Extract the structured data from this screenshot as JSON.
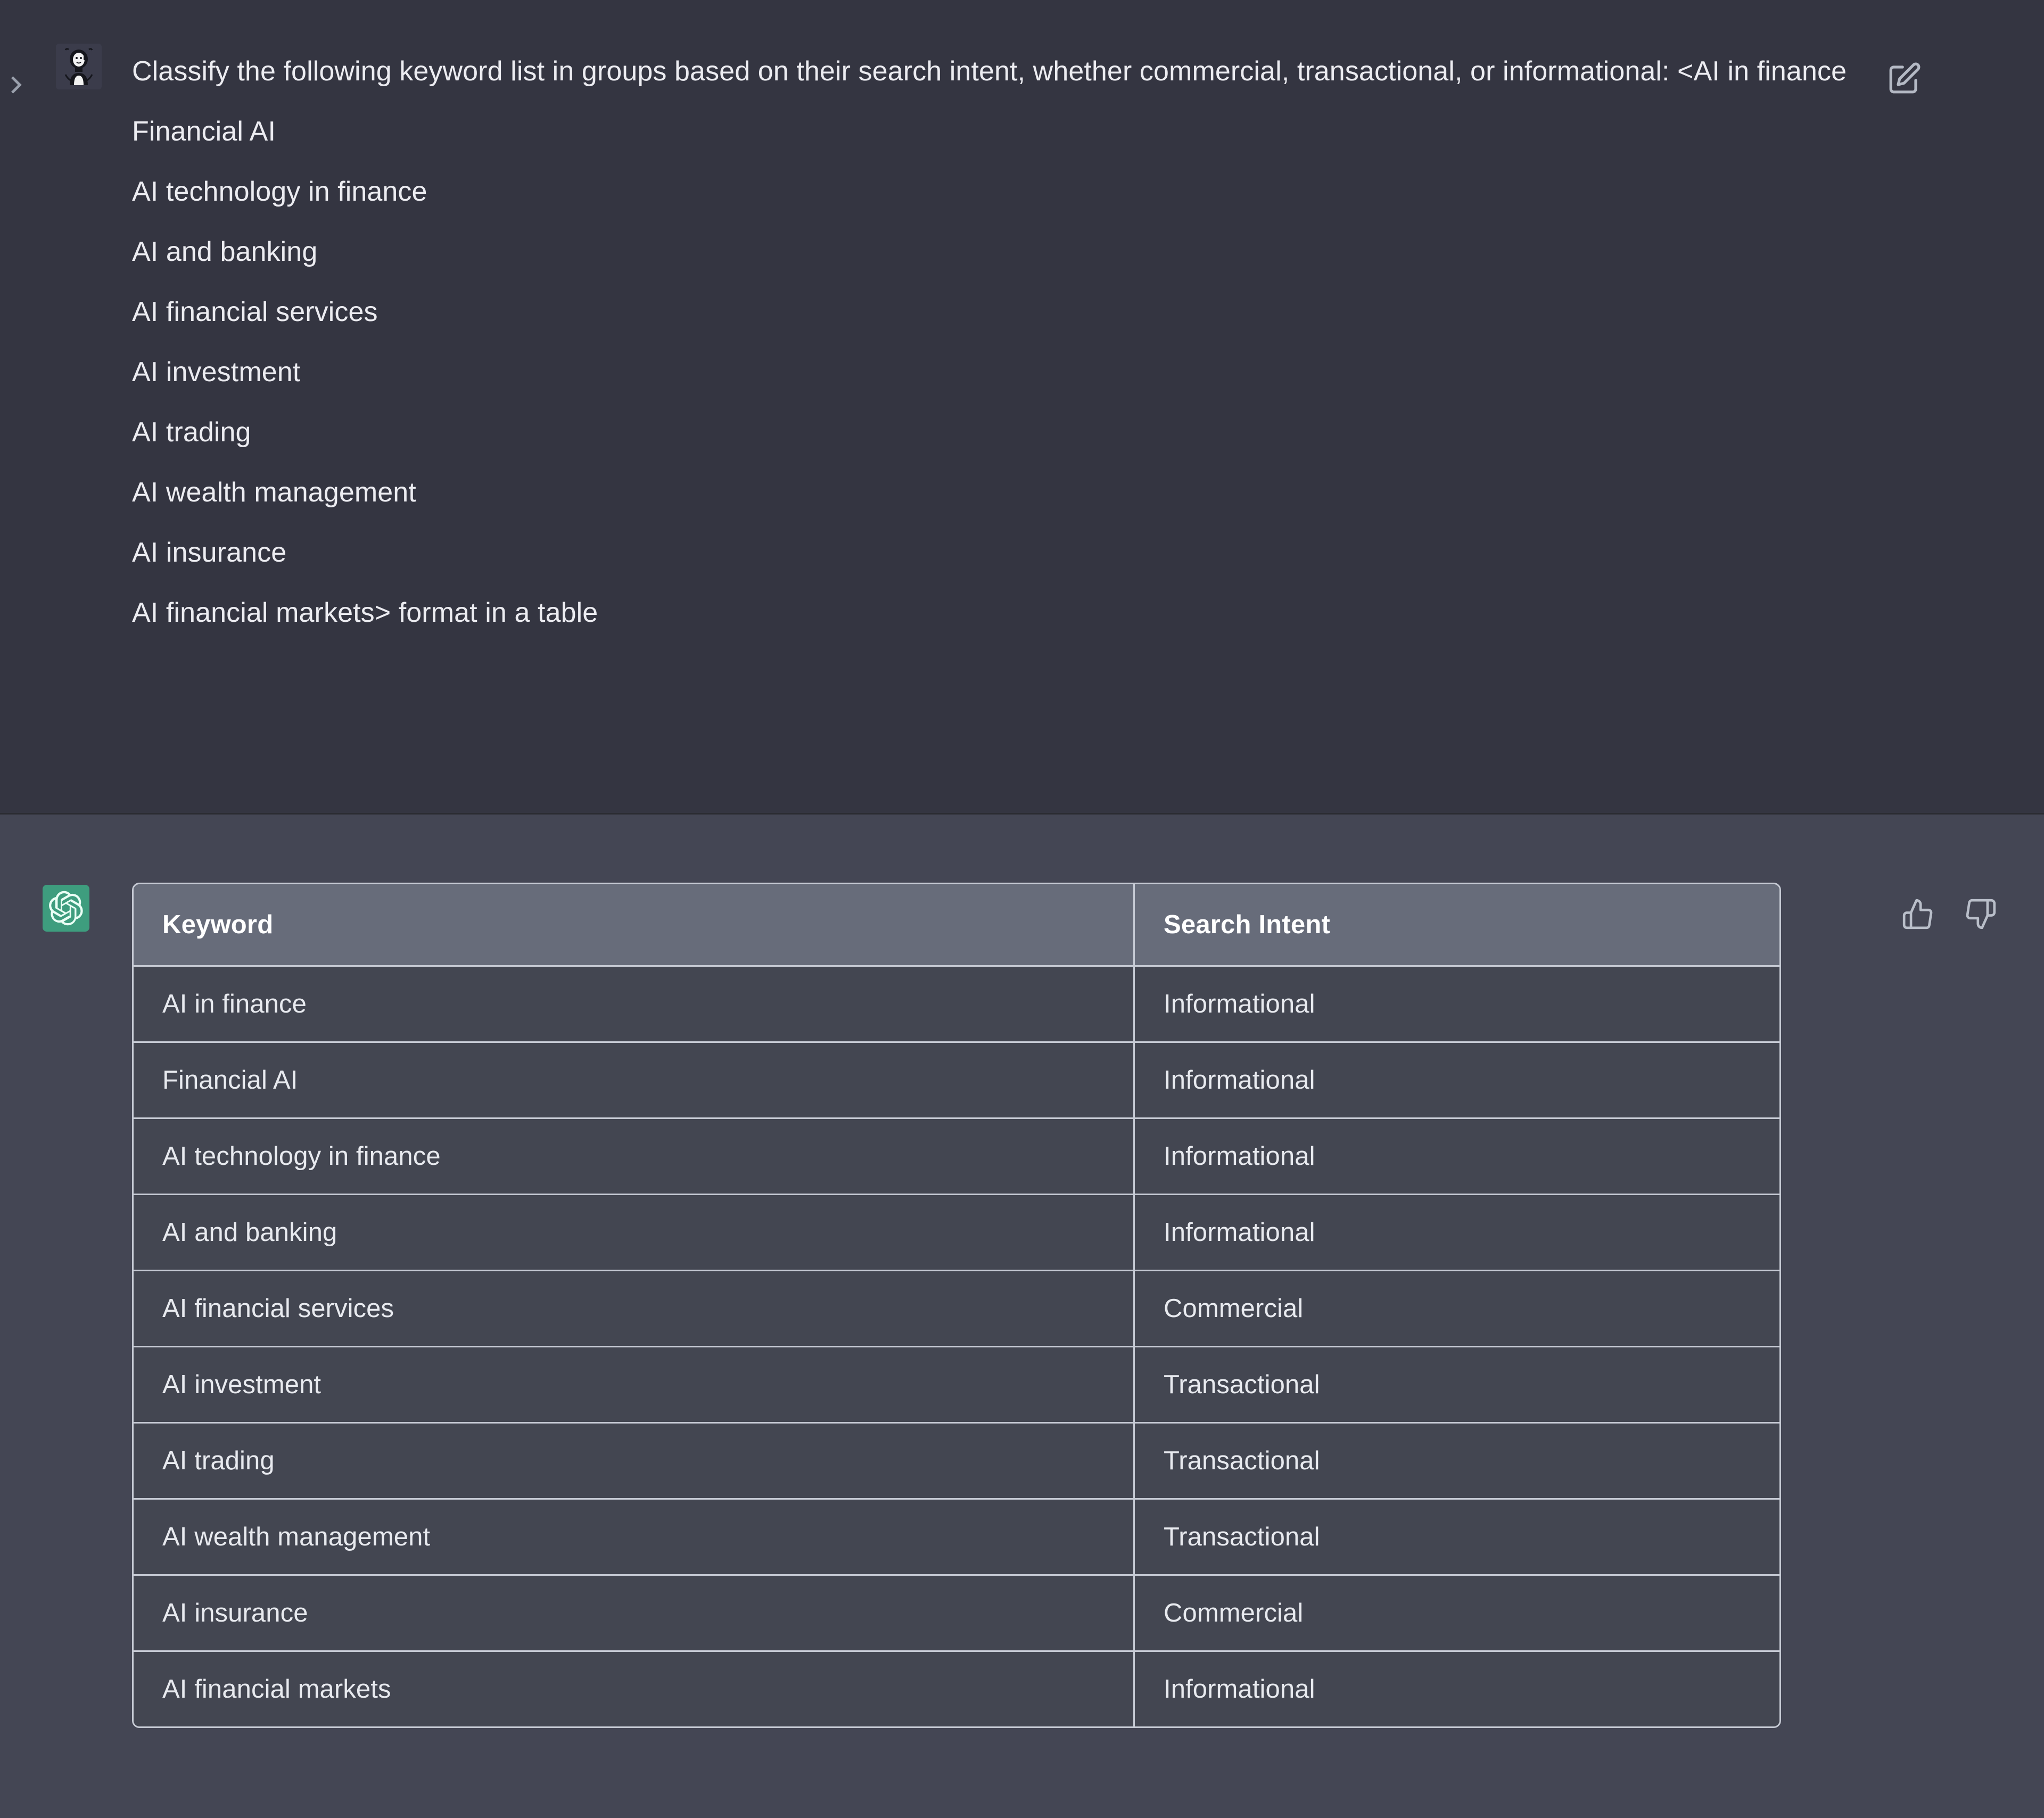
{
  "conversation": {
    "user_message": {
      "prompt_text": "Classify the following keyword list in groups based on their search intent, whether commercial, transactional, or informational: <AI in finance\nFinancial AI\nAI technology in finance\nAI and banking\nAI financial services\nAI investment\nAI trading\nAI wealth management\nAI insurance\nAI financial markets> format in a table",
      "edit_icon": "edit-pencil-square-icon",
      "collapse_icon": "chevron-right-icon",
      "avatar_icon": "user-avatar-illustration"
    },
    "assistant_message": {
      "avatar_icon": "chatgpt-logo-icon",
      "avatar_background": "#3e9d7e",
      "thumbs_up_icon": "thumbs-up-icon",
      "thumbs_down_icon": "thumbs-down-icon"
    }
  },
  "chart_data": {
    "type": "table",
    "title": "",
    "columns": [
      "Keyword",
      "Search Intent"
    ],
    "rows": [
      [
        "AI in finance",
        "Informational"
      ],
      [
        "Financial AI",
        "Informational"
      ],
      [
        "AI technology in finance",
        "Informational"
      ],
      [
        "AI and banking",
        "Informational"
      ],
      [
        "AI financial services",
        "Commercial"
      ],
      [
        "AI investment",
        "Transactional"
      ],
      [
        "AI trading",
        "Transactional"
      ],
      [
        "AI wealth management",
        "Transactional"
      ],
      [
        "AI insurance",
        "Commercial"
      ],
      [
        "AI financial markets",
        "Informational"
      ]
    ]
  },
  "theme": {
    "user_turn_background": "#343541",
    "assistant_turn_background": "#444654",
    "table_header_background": "#676c7a",
    "table_row_background": "#434651",
    "table_border_color": "#c6cad4",
    "text_color": "#ececf1"
  }
}
